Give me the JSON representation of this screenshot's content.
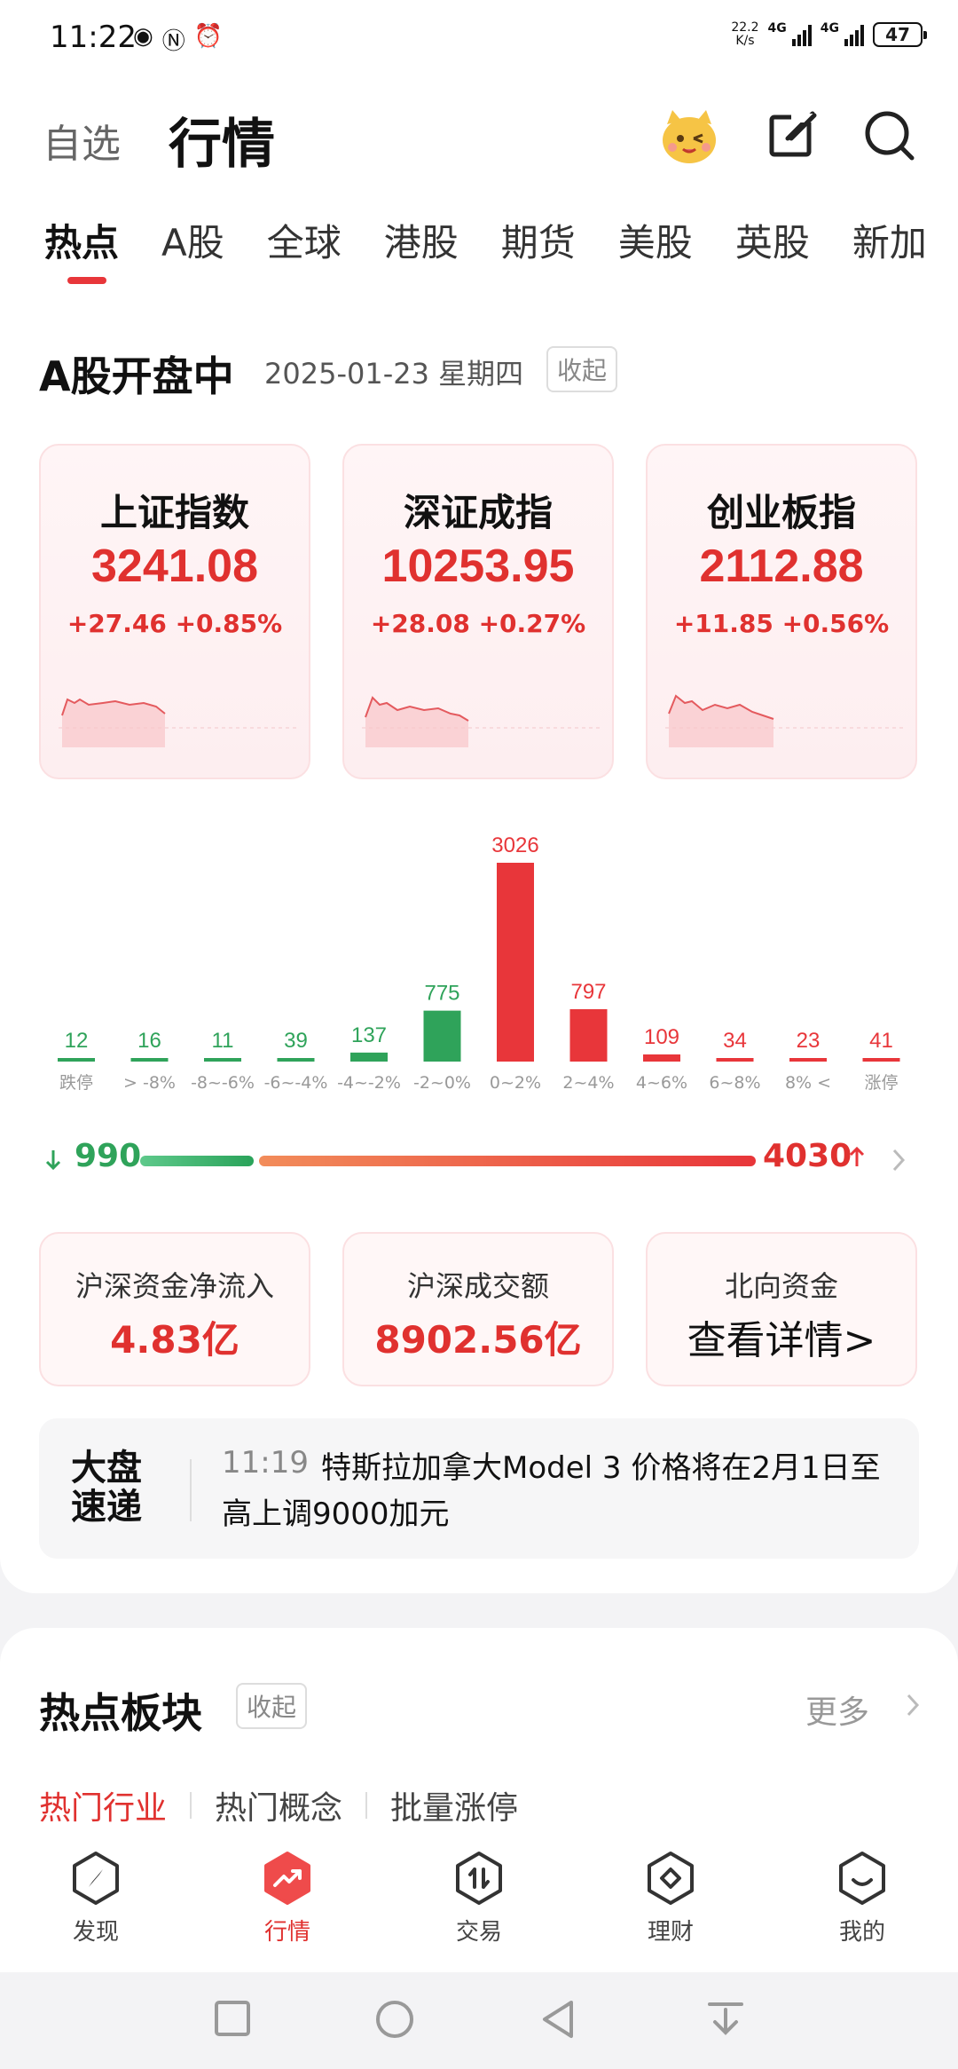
{
  "status_bar": {
    "time": "11:22",
    "net_speed": "22.2\nK/s",
    "net_type": "4G",
    "battery": "47"
  },
  "header": {
    "tab_watchlist": "自选",
    "tab_market": "行情",
    "icons": [
      "mascot-icon",
      "edit-icon",
      "search-icon"
    ]
  },
  "subtabs": [
    "热点",
    "A股",
    "全球",
    "港股",
    "期货",
    "美股",
    "英股",
    "新加"
  ],
  "market": {
    "title": "A股开盘中",
    "date": "2025-01-23 星期四",
    "collapse": "收起"
  },
  "indices": [
    {
      "name": "上证指数",
      "value": "3241.08",
      "change": "+27.46  +0.85%"
    },
    {
      "name": "深证成指",
      "value": "10253.95",
      "change": "+28.08  +0.27%"
    },
    {
      "name": "创业板指",
      "value": "2112.88",
      "change": "+11.85  +0.56%"
    }
  ],
  "chart_data": {
    "type": "bar",
    "categories": [
      "跌停",
      "> -8%",
      "-8~-6%",
      "-6~-4%",
      "-4~-2%",
      "-2~0%",
      "0~2%",
      "2~4%",
      "4~6%",
      "6~8%",
      "8% <",
      "涨停"
    ],
    "values": [
      12,
      16,
      11,
      39,
      137,
      775,
      3026,
      797,
      109,
      34,
      23,
      41
    ],
    "colors": [
      "#2fa35a",
      "#2fa35a",
      "#2fa35a",
      "#2fa35a",
      "#2fa35a",
      "#2fa35a",
      "#e8363a",
      "#e8363a",
      "#e8363a",
      "#e8363a",
      "#e8363a",
      "#e8363a"
    ]
  },
  "ratio": {
    "down": "990",
    "up": "4030"
  },
  "funds": [
    {
      "label": "沪深资金净流入",
      "value": "4.83亿"
    },
    {
      "label": "沪深成交额",
      "value": "8902.56亿"
    },
    {
      "label": "北向资金",
      "value": "查看详情>"
    }
  ],
  "news": {
    "logo_line1": "大盘",
    "logo_line2": "速递",
    "time": "11:19",
    "text": "特斯拉加拿大Model 3 价格将在2月1日至高上调9000加元"
  },
  "sector": {
    "title": "热点板块",
    "collapse": "收起",
    "more": "更多",
    "tabs": [
      "热门行业",
      "热门概念",
      "批量涨停"
    ]
  },
  "bottom_nav": [
    "发现",
    "行情",
    "交易",
    "理财",
    "我的"
  ],
  "colors": {
    "up": "#e0312f",
    "down": "#2fa35a",
    "accent": "#e8363a"
  }
}
